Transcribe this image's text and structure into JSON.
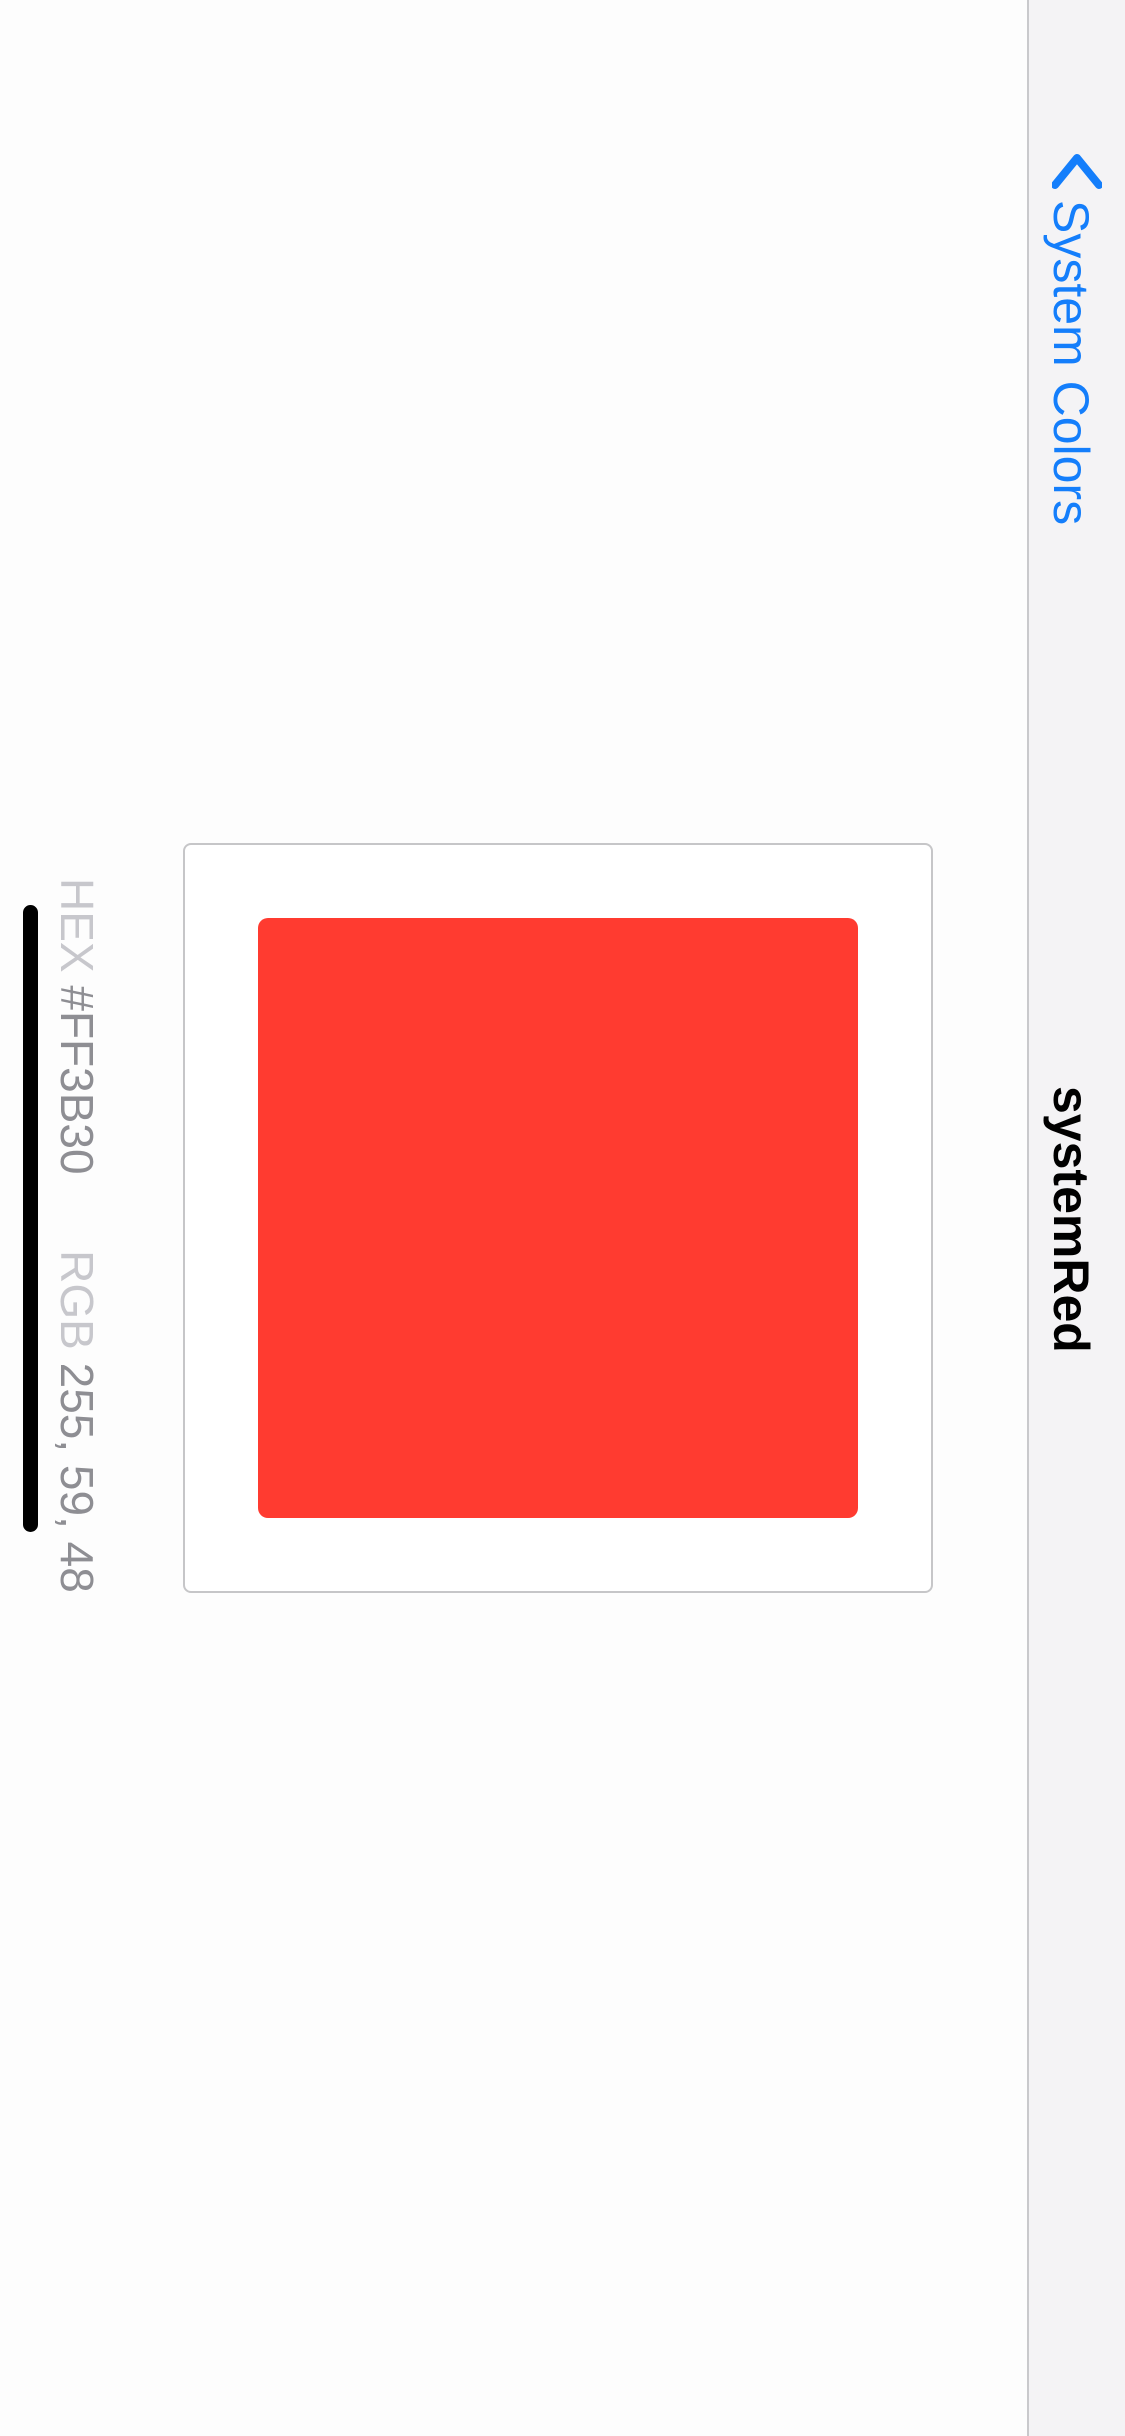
{
  "nav": {
    "back_label": "System Colors",
    "title": "systemRed"
  },
  "swatch": {
    "color": "#FF3B30"
  },
  "color_info": {
    "hex_label": "HEX",
    "hex_value": "#FF3B30",
    "rgb_label": "RGB",
    "rgb_value": "255, 59, 48"
  },
  "colors": {
    "accent": "#147EFB",
    "nav_background": "#F4F3F5",
    "secondary_text": "#8E8E93",
    "tertiary_text": "#C7C7CC"
  },
  "icons": {
    "back": "chevron-left-icon"
  }
}
